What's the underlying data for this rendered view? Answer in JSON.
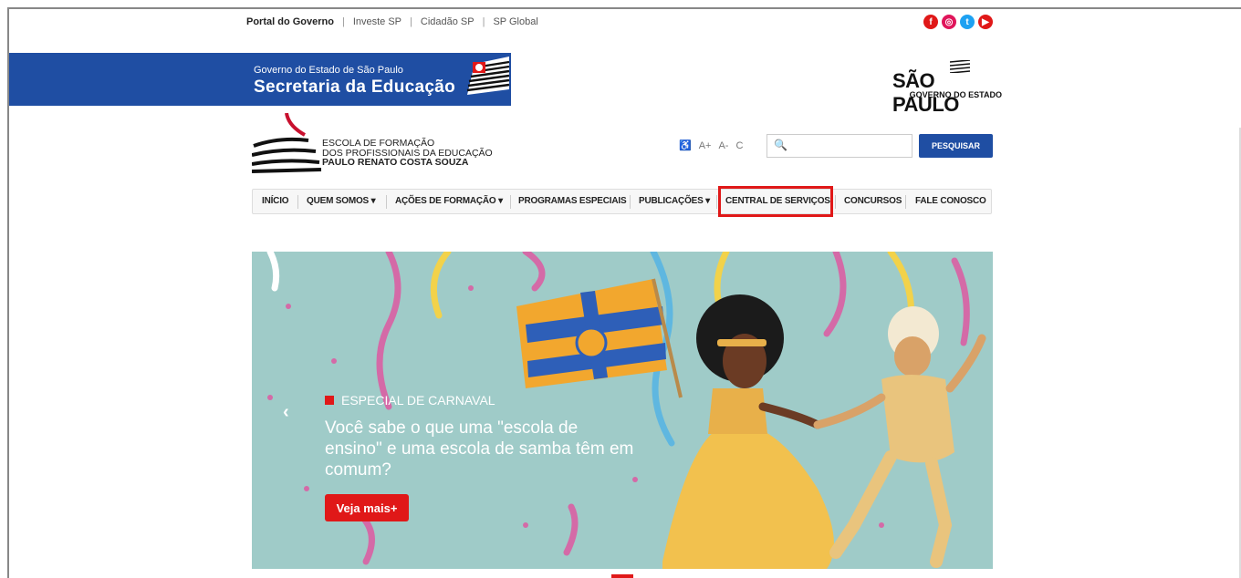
{
  "govbar": {
    "links": [
      "Portal do Governo",
      "Investe SP",
      "Cidadão SP",
      "SP Global"
    ],
    "social": [
      {
        "icon": "facebook-icon",
        "glyph": "f",
        "color": "#e01818"
      },
      {
        "icon": "instagram-icon",
        "glyph": "◎",
        "color": "#e0155a"
      },
      {
        "icon": "twitter-icon",
        "glyph": "t",
        "color": "#1da1f2"
      },
      {
        "icon": "youtube-icon",
        "glyph": "▶",
        "color": "#e01818"
      }
    ]
  },
  "banner": {
    "subtitle": "Governo do Estado de São Paulo",
    "title": "Secretaria da Educação",
    "sp_logo_main": "SÃO PAULO",
    "sp_logo_sub": "GOVERNO DO ESTADO"
  },
  "logo": {
    "line1": "ESCOLA DE FORMAÇÃO",
    "line2": "DOS PROFISSIONAIS DA EDUCAÇÃO",
    "line3": "PAULO RENATO COSTA SOUZA"
  },
  "toolbar": {
    "a_plus": "A+",
    "a_minus": "A-",
    "contrast": "C",
    "search_placeholder": "",
    "search_button": "PESQUISAR"
  },
  "nav": {
    "items": [
      {
        "label": "INÍCIO"
      },
      {
        "label": "QUEM SOMOS ▾"
      },
      {
        "label": "AÇÕES DE FORMAÇÃO ▾"
      },
      {
        "label": "PROGRAMAS ESPECIAIS"
      },
      {
        "label": "PUBLICAÇÕES ▾"
      },
      {
        "label": "CENTRAL DE SERVIÇOS"
      },
      {
        "label": "CONCURSOS"
      },
      {
        "label": "FALE CONOSCO"
      }
    ]
  },
  "hero": {
    "tag": "ESPECIAL DE CARNAVAL",
    "headline": "Você sabe o que uma \"escola de ensino\" e uma escola de samba têm em comum?",
    "button": "Veja mais+",
    "prev_glyph": "‹"
  },
  "colors": {
    "brand_blue": "#1f4ea3",
    "accent_red": "#e01818",
    "hero_bg": "#9fcbc8"
  }
}
